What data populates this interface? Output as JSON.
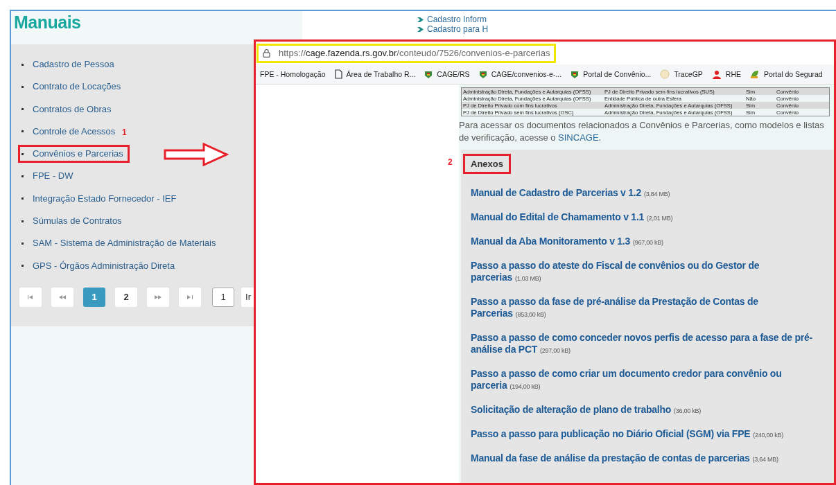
{
  "page": {
    "title": "Manuais",
    "manuals": [
      {
        "label": "Cadastro de Pessoa",
        "highlighted": false
      },
      {
        "label": "Contrato de Locações",
        "highlighted": false
      },
      {
        "label": "Contratos de Obras",
        "highlighted": false
      },
      {
        "label": "Controle de Acessos",
        "highlighted": false
      },
      {
        "label": "Convênios e Parcerias",
        "highlighted": true
      },
      {
        "label": "FPE - DW",
        "highlighted": false
      },
      {
        "label": "Integração Estado Fornecedor - IEF",
        "highlighted": false
      },
      {
        "label": "Súmulas de Contratos",
        "highlighted": false
      },
      {
        "label": "SAM - Sistema de Administração de Materiais",
        "highlighted": false
      },
      {
        "label": "GPS - Órgãos Administração Direta",
        "highlighted": false
      }
    ],
    "pages": [
      {
        "label": "1",
        "selected": true
      },
      {
        "label": "2",
        "selected": false
      }
    ],
    "page_input": "1",
    "go_button": "Ir",
    "side_links": [
      "Cadastro Inform",
      "Cadastro para H"
    ]
  },
  "annotations": {
    "marker_1": "1",
    "marker_2": "2"
  },
  "browser": {
    "url_scheme": "https://",
    "url_host": "cage.fazenda.rs.gov.br",
    "url_path": "/conteudo/7526/convenios-e-parcerias",
    "bookmarks": [
      {
        "label": "FPE - Homologação",
        "kind": "plain"
      },
      {
        "label": "Área de Trabalho R...",
        "kind": "page"
      },
      {
        "label": "CAGE/RS",
        "kind": "crest"
      },
      {
        "label": "CAGE/convenios-e-...",
        "kind": "crest"
      },
      {
        "label": "Portal de Convênio...",
        "kind": "crest"
      },
      {
        "label": "TraceGP",
        "kind": "globe"
      },
      {
        "label": "RHE",
        "kind": "person"
      },
      {
        "label": "Portal do Segurad",
        "kind": "leaf"
      }
    ],
    "table": {
      "rows": [
        [
          "Administração Direta, Fundações e Autarquias (OFSS)",
          "PJ de Direito Privado sem fins lucrativos (SUS)",
          "Sim",
          "Convênio"
        ],
        [
          "Administração Direta, Fundações e Autarquias (OFSS)",
          "Entidade Pública de outra Esfera",
          "Não",
          "Convênio"
        ],
        [
          "PJ de Direito Privado com fins lucrativos",
          "Administração Direta, Fundações e Autarquias (OFSS)",
          "Sim",
          "Convênio"
        ],
        [
          "PJ de Direito Privado sem fins lucrativos (OSC)",
          "Administração Direta, Fundações e Autarquias (OFSS)",
          "Sim",
          "Convênio"
        ]
      ]
    },
    "notice": {
      "text": "Para acessar os documentos relacionados a Convênios e Parcerias, como modelos e listas de verificação, acesse o ",
      "link": "SINCAGE",
      "end": "."
    },
    "attachments": {
      "heading": "Anexos",
      "items": [
        {
          "title": "Manual de Cadastro de Parcerias v 1.2",
          "size": "(3,84 MB)"
        },
        {
          "title": "Manual do Edital de Chamamento v 1.1",
          "size": "(2,01 MB)"
        },
        {
          "title": "Manual da Aba Monitoramento v 1.3",
          "size": "(967,00 kB)"
        },
        {
          "title": "Passo a passo do ateste do Fiscal de convênios ou do Gestor de parcerias",
          "size": "(1,03 MB)"
        },
        {
          "title": "Passo a passo da fase de pré-análise da Prestação de Contas de Parcerias",
          "size": "(853,00 kB)"
        },
        {
          "title": "Passo a passo de como conceder novos perfis de acesso para a fase de pré-análise da PCT",
          "size": "(297,00 kB)"
        },
        {
          "title": "Passo a passo de como criar um documento credor para convênio ou parceria",
          "size": "(194,00 kB)"
        },
        {
          "title": "Solicitação de alteração de plano de trabalho",
          "size": "(36,00 kB)"
        },
        {
          "title": "Passo a passo para publicação no Diário Oficial (SGM) via FPE",
          "size": "(240,00 kB)"
        },
        {
          "title": "Manual da fase de análise da prestação de contas de parcerias",
          "size": "(3,64 MB)"
        }
      ]
    }
  }
}
